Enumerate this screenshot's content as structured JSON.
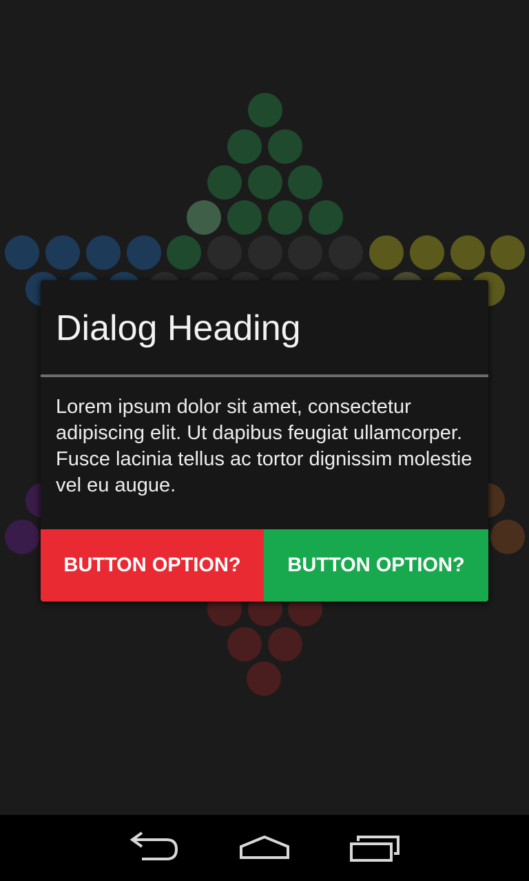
{
  "dialog": {
    "title": "Dialog Heading",
    "body": "Lorem ipsum dolor sit amet, consectetur adipiscing elit. Ut dapibus feugiat ullamcorper. Fusce lacinia tellus ac tortor dignissim molestie vel eu augue.",
    "negative_button": "BUTTON OPTION?",
    "positive_button": "BUTTON OPTION?",
    "negative_color": "#ea2a33",
    "positive_color": "#18a94f"
  },
  "board": {
    "background_color": "#1b1b1b",
    "peg_colors": {
      "green": "#1f4a2d",
      "green_light": "#3f5f48",
      "blue": "#1d3a58",
      "yellow": "#5b5a1c",
      "yellow_light": "#4a4a30",
      "empty": "#2a2a2a",
      "purple": "#3a1c4a",
      "orange": "#4a2f1c",
      "red": "#4a1d1e"
    }
  },
  "navbar": {
    "back_icon": "back-arrow-icon",
    "home_icon": "home-icon",
    "recents_icon": "recent-apps-icon"
  }
}
